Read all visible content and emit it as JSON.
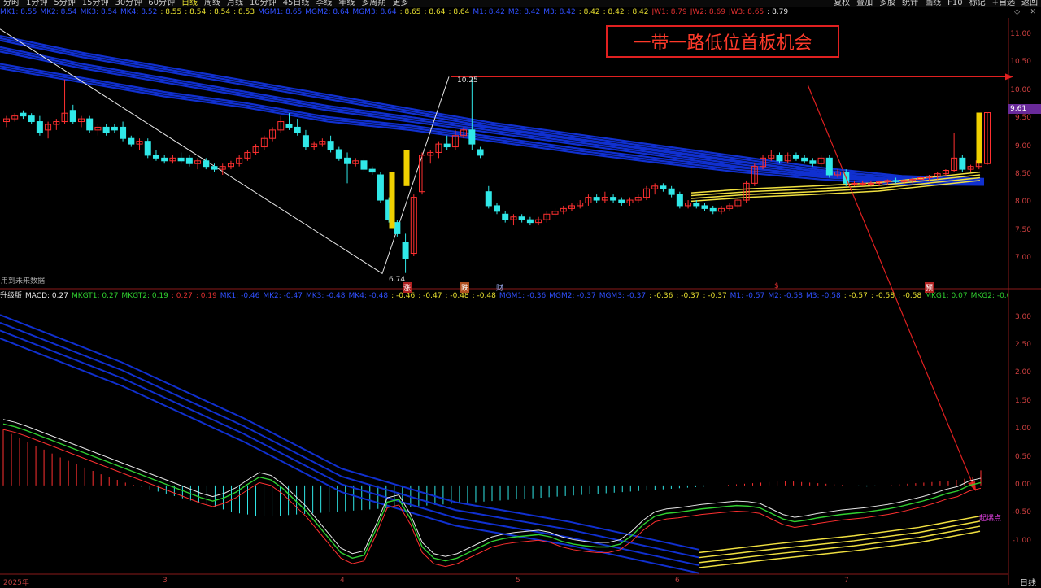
{
  "toolbar": {
    "left_items": [
      "分时",
      "1分钟",
      "5分钟",
      "15分钟",
      "30分钟",
      "60分钟",
      "日线",
      "周线",
      "月线",
      "10分钟",
      "45日线",
      "季线",
      "年线",
      "多周期",
      "更多"
    ],
    "active_index": 6,
    "right_items": [
      "复权",
      "叠加",
      "多股",
      "统计",
      "画线",
      "F10",
      "标记",
      "+自选",
      "返回"
    ]
  },
  "legend_main": [
    {
      "t": "MK1: 8.55",
      "c": "#3050ff"
    },
    {
      "t": "MK2: 8.54",
      "c": "#3050ff"
    },
    {
      "t": "MK3: 8.54",
      "c": "#3050ff"
    },
    {
      "t": "MK4: 8.52",
      "c": "#3050ff"
    },
    {
      "t": ": 8.55",
      "c": "#e8e030"
    },
    {
      "t": ": 8.54",
      "c": "#e8e030"
    },
    {
      "t": ": 8.54",
      "c": "#e8e030"
    },
    {
      "t": ": 8.53",
      "c": "#e8e030"
    },
    {
      "t": "MGM1: 8.65",
      "c": "#3050ff"
    },
    {
      "t": "MGM2: 8.64",
      "c": "#3050ff"
    },
    {
      "t": "MGM3: 8.64",
      "c": "#3050ff"
    },
    {
      "t": ": 8.65",
      "c": "#e8e030"
    },
    {
      "t": ": 8.64",
      "c": "#e8e030"
    },
    {
      "t": ": 8.64",
      "c": "#e8e030"
    },
    {
      "t": "M1: 8.42",
      "c": "#3050ff"
    },
    {
      "t": "M2: 8.42",
      "c": "#3050ff"
    },
    {
      "t": "M3: 8.42",
      "c": "#3050ff"
    },
    {
      "t": ": 8.42",
      "c": "#e8e030"
    },
    {
      "t": ": 8.42",
      "c": "#e8e030"
    },
    {
      "t": ": 8.42",
      "c": "#e8e030"
    },
    {
      "t": "JW1: 8.79",
      "c": "#e03030"
    },
    {
      "t": "JW2: 8.69",
      "c": "#e03030"
    },
    {
      "t": "JW3: 8.65",
      "c": "#e03030"
    },
    {
      "t": ": 8.79",
      "c": "#e8e8e8"
    }
  ],
  "legend_sub": [
    {
      "t": "升级版",
      "c": "#e8e8e8"
    },
    {
      "t": "MACD: 0.27",
      "c": "#e8e8e8"
    },
    {
      "t": "MKGT1: 0.27",
      "c": "#30d030"
    },
    {
      "t": "MKGT2: 0.19",
      "c": "#30d030"
    },
    {
      "t": ": 0.27",
      "c": "#e03030"
    },
    {
      "t": ": 0.19",
      "c": "#e03030"
    },
    {
      "t": "MK1: -0.46",
      "c": "#3050ff"
    },
    {
      "t": "MK2: -0.47",
      "c": "#3050ff"
    },
    {
      "t": "MK3: -0.48",
      "c": "#3050ff"
    },
    {
      "t": "MK4: -0.48",
      "c": "#3050ff"
    },
    {
      "t": ": -0.46",
      "c": "#e8e030"
    },
    {
      "t": ": -0.47",
      "c": "#e8e030"
    },
    {
      "t": ": -0.48",
      "c": "#e8e030"
    },
    {
      "t": ": -0.48",
      "c": "#e8e030"
    },
    {
      "t": "MGM1: -0.36",
      "c": "#3050ff"
    },
    {
      "t": "MGM2: -0.37",
      "c": "#3050ff"
    },
    {
      "t": "MGM3: -0.37",
      "c": "#3050ff"
    },
    {
      "t": ": -0.36",
      "c": "#e8e030"
    },
    {
      "t": ": -0.37",
      "c": "#e8e030"
    },
    {
      "t": ": -0.37",
      "c": "#e8e030"
    },
    {
      "t": "M1: -0.57",
      "c": "#3050ff"
    },
    {
      "t": "M2: -0.58",
      "c": "#3050ff"
    },
    {
      "t": "M3: -0.58",
      "c": "#3050ff"
    },
    {
      "t": ": -0.57",
      "c": "#e8e030"
    },
    {
      "t": ": -0.58",
      "c": "#e8e030"
    },
    {
      "t": ": -0.58",
      "c": "#e8e030"
    },
    {
      "t": "MKG1: 0.07",
      "c": "#30d030"
    },
    {
      "t": "MKG2: -0.03",
      "c": "#30d030"
    },
    {
      "t": "MKG3: -0.09",
      "c": "#30d030"
    },
    {
      "t": ": 0.07",
      "c": "#e03030"
    },
    {
      "t": ": -0.03",
      "c": "#e03030"
    }
  ],
  "annotation": {
    "title": "一带一路低位首板机会",
    "target_price": "10.25",
    "low_price": "6.74",
    "price_tag": "9.61",
    "breakout_label": "起爆点",
    "future_note": "用到未来数据"
  },
  "markers": [
    "涨",
    "跌",
    "财",
    "$",
    "预"
  ],
  "period": "日线",
  "colors": {
    "up": "#ff3030",
    "down": "#30e8e8",
    "ma_blue": "#1030d0",
    "ma_yellow": "#f0e040",
    "ma_green": "#30d030",
    "ma_white": "#e8e8e8",
    "accent_red": "#e02020"
  },
  "chart_data": [
    {
      "type": "candlestick",
      "title": "",
      "y_ticks": [
        11.0,
        10.5,
        10.0,
        9.5,
        9.0,
        8.5,
        8.0,
        7.5,
        7.0
      ],
      "ylim": [
        6.6,
        11.3
      ],
      "x_ticks": [
        "2025年",
        "3",
        "4",
        "5",
        "6",
        "7"
      ],
      "candles": [
        [
          9.45,
          9.55,
          9.35,
          9.5
        ],
        [
          9.5,
          9.6,
          9.45,
          9.55
        ],
        [
          9.6,
          9.65,
          9.5,
          9.55
        ],
        [
          9.55,
          9.6,
          9.4,
          9.45
        ],
        [
          9.45,
          9.55,
          9.2,
          9.25
        ],
        [
          9.3,
          9.45,
          9.15,
          9.4
        ],
        [
          9.4,
          9.5,
          9.3,
          9.45
        ],
        [
          9.45,
          10.2,
          9.4,
          9.6
        ],
        [
          9.65,
          9.75,
          9.4,
          9.45
        ],
        [
          9.45,
          9.55,
          9.35,
          9.5
        ],
        [
          9.5,
          9.55,
          9.25,
          9.3
        ],
        [
          9.3,
          9.4,
          9.2,
          9.35
        ],
        [
          9.35,
          9.4,
          9.2,
          9.25
        ],
        [
          9.35,
          9.4,
          9.25,
          9.3
        ],
        [
          9.35,
          9.45,
          9.1,
          9.15
        ],
        [
          9.15,
          9.2,
          9.0,
          9.05
        ],
        [
          9.05,
          9.15,
          8.95,
          9.1
        ],
        [
          9.1,
          9.15,
          8.8,
          8.85
        ],
        [
          8.85,
          8.95,
          8.75,
          8.8
        ],
        [
          8.8,
          8.85,
          8.7,
          8.75
        ],
        [
          8.75,
          8.85,
          8.7,
          8.8
        ],
        [
          8.8,
          8.9,
          8.7,
          8.75
        ],
        [
          8.8,
          8.85,
          8.65,
          8.7
        ],
        [
          8.7,
          8.8,
          8.6,
          8.75
        ],
        [
          8.75,
          8.8,
          8.6,
          8.65
        ],
        [
          8.65,
          8.7,
          8.55,
          8.6
        ],
        [
          8.6,
          8.7,
          8.5,
          8.65
        ],
        [
          8.65,
          8.75,
          8.6,
          8.7
        ],
        [
          8.7,
          8.85,
          8.65,
          8.8
        ],
        [
          8.8,
          8.95,
          8.75,
          8.9
        ],
        [
          8.9,
          9.05,
          8.85,
          9.0
        ],
        [
          9.0,
          9.2,
          8.95,
          9.15
        ],
        [
          9.15,
          9.35,
          9.1,
          9.3
        ],
        [
          9.3,
          9.55,
          9.25,
          9.45
        ],
        [
          9.4,
          9.6,
          9.3,
          9.35
        ],
        [
          9.35,
          9.5,
          9.2,
          9.25
        ],
        [
          9.2,
          9.3,
          8.95,
          9.0
        ],
        [
          9.0,
          9.1,
          8.95,
          9.05
        ],
        [
          9.05,
          9.15,
          9.0,
          9.1
        ],
        [
          9.1,
          9.2,
          8.9,
          8.95
        ],
        [
          8.95,
          9.0,
          8.75,
          8.8
        ],
        [
          8.8,
          8.9,
          8.35,
          8.7
        ],
        [
          8.7,
          8.8,
          8.65,
          8.75
        ],
        [
          8.75,
          8.8,
          8.55,
          8.6
        ],
        [
          8.6,
          8.65,
          8.5,
          8.55
        ],
        [
          8.5,
          8.55,
          8.0,
          8.05
        ],
        [
          8.05,
          8.1,
          7.65,
          7.7
        ],
        [
          7.65,
          7.7,
          7.4,
          7.45
        ],
        [
          7.3,
          7.45,
          6.75,
          7.0
        ],
        [
          7.1,
          8.15,
          7.05,
          8.1
        ],
        [
          8.2,
          8.9,
          8.15,
          8.85
        ],
        [
          8.85,
          8.95,
          8.7,
          8.9
        ],
        [
          8.9,
          9.1,
          8.8,
          9.05
        ],
        [
          9.05,
          9.2,
          8.95,
          9.0
        ],
        [
          9.0,
          9.3,
          8.95,
          9.2
        ],
        [
          9.2,
          9.35,
          9.15,
          9.3
        ],
        [
          9.3,
          10.25,
          8.95,
          9.05
        ],
        [
          8.95,
          9.0,
          8.8,
          8.85
        ],
        [
          8.2,
          8.3,
          7.9,
          7.95
        ],
        [
          7.95,
          8.0,
          7.8,
          7.85
        ],
        [
          7.8,
          7.85,
          7.65,
          7.7
        ],
        [
          7.7,
          7.8,
          7.6,
          7.75
        ],
        [
          7.75,
          7.8,
          7.65,
          7.7
        ],
        [
          7.7,
          7.75,
          7.6,
          7.65
        ],
        [
          7.65,
          7.75,
          7.6,
          7.7
        ],
        [
          7.7,
          7.85,
          7.65,
          7.8
        ],
        [
          7.8,
          7.9,
          7.75,
          7.85
        ],
        [
          7.85,
          7.95,
          7.8,
          7.9
        ],
        [
          7.9,
          8.0,
          7.85,
          7.95
        ],
        [
          7.95,
          8.05,
          7.9,
          8.0
        ],
        [
          8.0,
          8.15,
          7.95,
          8.1
        ],
        [
          8.1,
          8.15,
          8.0,
          8.05
        ],
        [
          8.05,
          8.2,
          8.0,
          8.1
        ],
        [
          8.1,
          8.15,
          8.0,
          8.05
        ],
        [
          8.05,
          8.1,
          7.95,
          8.0
        ],
        [
          8.0,
          8.1,
          7.95,
          8.05
        ],
        [
          8.05,
          8.15,
          8.0,
          8.1
        ],
        [
          8.1,
          8.3,
          8.05,
          8.25
        ],
        [
          8.25,
          8.35,
          8.15,
          8.3
        ],
        [
          8.3,
          8.35,
          8.2,
          8.25
        ],
        [
          8.25,
          8.3,
          8.1,
          8.15
        ],
        [
          8.15,
          8.2,
          7.9,
          7.95
        ],
        [
          7.95,
          8.05,
          7.9,
          8.0
        ],
        [
          8.0,
          8.05,
          7.9,
          7.95
        ],
        [
          7.95,
          8.0,
          7.85,
          7.9
        ],
        [
          7.9,
          7.95,
          7.8,
          7.85
        ],
        [
          7.85,
          7.95,
          7.8,
          7.9
        ],
        [
          7.9,
          8.0,
          7.85,
          7.95
        ],
        [
          7.95,
          8.1,
          7.9,
          8.05
        ],
        [
          8.05,
          8.4,
          8.0,
          8.35
        ],
        [
          8.35,
          8.7,
          8.3,
          8.65
        ],
        [
          8.65,
          8.85,
          8.6,
          8.8
        ],
        [
          8.8,
          8.95,
          8.75,
          8.85
        ],
        [
          8.85,
          8.9,
          8.7,
          8.75
        ],
        [
          8.75,
          8.9,
          8.7,
          8.85
        ],
        [
          8.85,
          8.9,
          8.75,
          8.8
        ],
        [
          8.8,
          8.85,
          8.7,
          8.75
        ],
        [
          8.75,
          8.8,
          8.65,
          8.7
        ],
        [
          8.7,
          8.85,
          8.65,
          8.8
        ],
        [
          8.8,
          8.85,
          8.45,
          8.5
        ],
        [
          8.5,
          8.6,
          8.45,
          8.55
        ],
        [
          8.55,
          8.6,
          8.3,
          8.35
        ],
        [
          8.35,
          8.4,
          8.3,
          8.35
        ],
        [
          8.35,
          8.4,
          8.3,
          8.35
        ],
        [
          8.35,
          8.4,
          8.3,
          8.35
        ],
        [
          8.35,
          8.4,
          8.3,
          8.38
        ],
        [
          8.38,
          8.42,
          8.32,
          8.4
        ],
        [
          8.4,
          8.45,
          8.35,
          8.38
        ],
        [
          8.38,
          8.42,
          8.33,
          8.4
        ],
        [
          8.4,
          8.45,
          8.35,
          8.42
        ],
        [
          8.42,
          8.48,
          8.38,
          8.45
        ],
        [
          8.45,
          8.5,
          8.4,
          8.48
        ],
        [
          8.48,
          8.55,
          8.42,
          8.52
        ],
        [
          8.52,
          8.6,
          8.48,
          8.58
        ],
        [
          8.58,
          9.25,
          8.55,
          8.8
        ],
        [
          8.8,
          8.85,
          8.55,
          8.6
        ],
        [
          8.6,
          8.68,
          8.55,
          8.65
        ],
        [
          8.65,
          8.78,
          8.6,
          8.75
        ],
        [
          8.7,
          9.61,
          8.68,
          9.61
        ]
      ],
      "ma_blue_bands": [
        [
          10.9,
          10.6,
          10.35,
          10.1,
          9.85,
          9.6,
          9.35,
          9.15,
          8.95,
          8.75,
          8.55,
          8.4,
          8.35
        ],
        [
          10.7,
          10.4,
          10.15,
          9.9,
          9.65,
          9.45,
          9.25,
          9.05,
          8.85,
          8.65,
          8.48,
          8.38,
          8.34
        ],
        [
          10.4,
          10.15,
          9.9,
          9.7,
          9.45,
          9.3,
          9.1,
          8.9,
          8.72,
          8.55,
          8.42,
          8.33,
          8.32
        ]
      ],
      "target_line_price": 10.25
    },
    {
      "type": "macd",
      "y_ticks": [
        3.0,
        2.5,
        2.0,
        1.5,
        1.0,
        0.5,
        0.0,
        -0.5,
        -1.0
      ],
      "ylim": [
        -1.5,
        3.3
      ],
      "macd_hist": [
        1.0,
        0.92,
        0.85,
        0.78,
        0.71,
        0.64,
        0.57,
        0.5,
        0.44,
        0.38,
        0.32,
        0.26,
        0.2,
        0.15,
        0.1,
        0.05,
        0.01,
        -0.03,
        -0.07,
        -0.11,
        -0.15,
        -0.19,
        -0.23,
        -0.27,
        -0.31,
        -0.35,
        -0.39,
        -0.43,
        -0.47,
        -0.5,
        -0.52,
        -0.54,
        -0.55,
        -0.55,
        -0.54,
        -0.53,
        -0.52,
        -0.51,
        -0.5,
        -0.49,
        -0.48,
        -0.47,
        -0.46,
        -0.45,
        -0.44,
        -0.43,
        -0.42,
        -0.41,
        -0.4,
        -0.39,
        -0.38,
        -0.37,
        -0.36,
        -0.35,
        -0.34,
        -0.33,
        -0.32,
        -0.31,
        -0.3,
        -0.29,
        -0.28,
        -0.27,
        -0.26,
        -0.25,
        -0.24,
        -0.23,
        -0.22,
        -0.21,
        -0.2,
        -0.19,
        -0.18,
        -0.17,
        -0.16,
        -0.15,
        -0.14,
        -0.13,
        -0.12,
        -0.11,
        -0.1,
        -0.09,
        -0.08,
        -0.07,
        -0.06,
        -0.05,
        -0.04,
        -0.03,
        -0.02,
        -0.01,
        0.0,
        0.01,
        0.02,
        0.03,
        0.04,
        0.05,
        0.06,
        0.07,
        0.08,
        0.07,
        0.06,
        0.05,
        0.04,
        0.03,
        0.02,
        0.01,
        0.0,
        -0.01,
        -0.02,
        -0.01,
        0.0,
        0.01,
        0.02,
        0.03,
        0.04,
        0.05,
        0.06,
        0.07,
        0.08,
        0.1,
        0.12,
        0.15,
        0.27
      ],
      "dif": [
        1.1,
        1.05,
        0.98,
        0.9,
        0.82,
        0.74,
        0.66,
        0.58,
        0.5,
        0.42,
        0.34,
        0.26,
        0.18,
        0.1,
        0.02,
        -0.06,
        -0.14,
        -0.22,
        -0.28,
        -0.22,
        -0.12,
        0.02,
        0.15,
        0.1,
        -0.05,
        -0.25,
        -0.45,
        -0.7,
        -0.95,
        -1.2,
        -1.3,
        -1.25,
        -0.8,
        -0.3,
        -0.25,
        -0.6,
        -1.1,
        -1.3,
        -1.35,
        -1.3,
        -1.2,
        -1.1,
        -1.0,
        -0.95,
        -0.92,
        -0.9,
        -0.88,
        -0.92,
        -1.0,
        -1.05,
        -1.08,
        -1.1,
        -1.1,
        -1.05,
        -0.9,
        -0.7,
        -0.55,
        -0.5,
        -0.48,
        -0.45,
        -0.42,
        -0.4,
        -0.38,
        -0.36,
        -0.37,
        -0.4,
        -0.5,
        -0.6,
        -0.65,
        -0.62,
        -0.58,
        -0.55,
        -0.52,
        -0.5,
        -0.48,
        -0.45,
        -0.42,
        -0.38,
        -0.33,
        -0.28,
        -0.22,
        -0.15,
        -0.1,
        0.0,
        0.05
      ]
    }
  ]
}
